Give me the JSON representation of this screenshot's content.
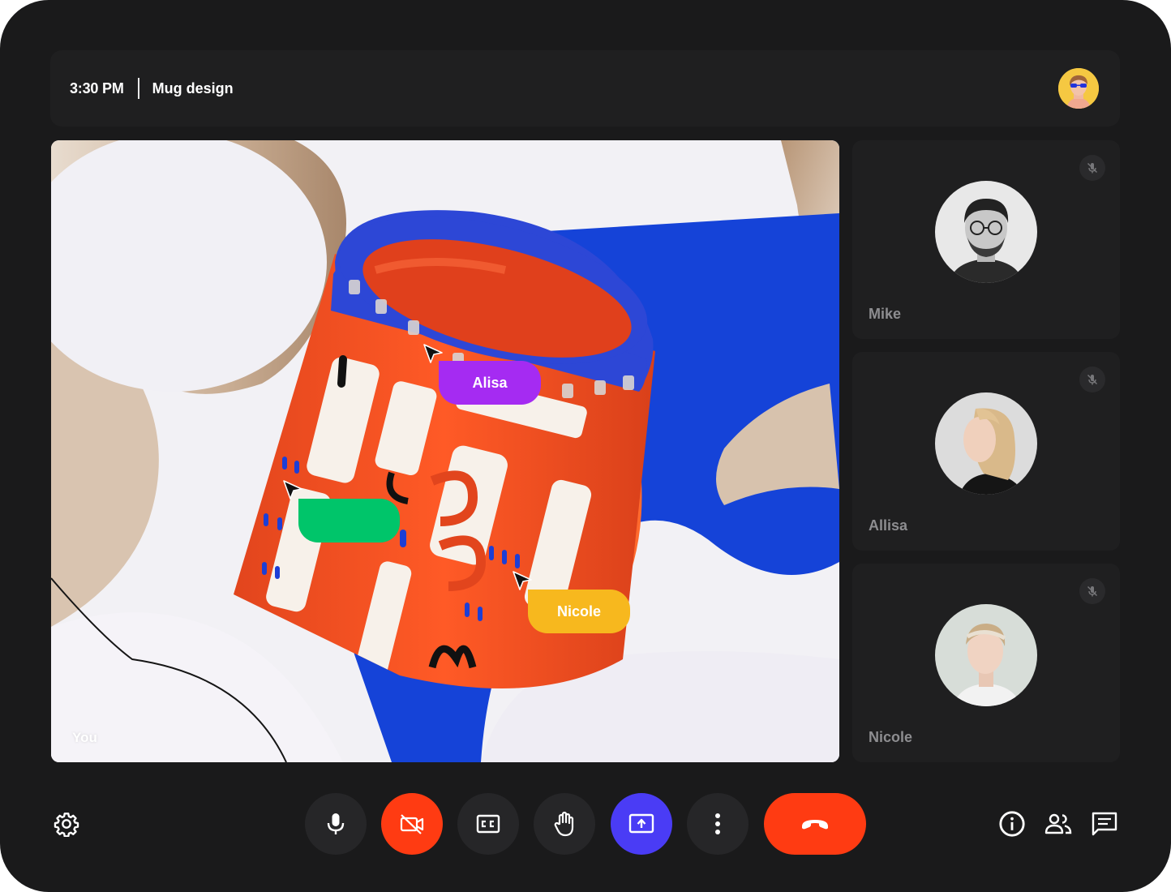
{
  "header": {
    "time": "3:30 PM",
    "meeting_title": "Mug design",
    "self_avatar_icon": "user-avatar"
  },
  "stage": {
    "self_label": "You",
    "cursors": [
      {
        "name": "Alisa",
        "color": "#a52bf2"
      },
      {
        "name": "",
        "color": "#00c56a"
      },
      {
        "name": "Nicole",
        "color": "#f7b81e"
      }
    ]
  },
  "participants": [
    {
      "name": "Mike",
      "muted": true,
      "icon": "mic-off-icon"
    },
    {
      "name": "Allisa",
      "muted": true,
      "icon": "mic-off-icon"
    },
    {
      "name": "Nicole",
      "muted": true,
      "icon": "mic-off-icon"
    }
  ],
  "controls": {
    "settings_icon": "gear-icon",
    "mic_icon": "microphone-icon",
    "camera_icon": "camera-off-icon",
    "captions_icon": "closed-captions-icon",
    "raise_hand_icon": "hand-icon",
    "share_screen_icon": "present-screen-icon",
    "more_icon": "more-vertical-icon",
    "end_call_icon": "phone-hangup-icon",
    "info_icon": "info-icon",
    "people_icon": "people-icon",
    "chat_icon": "chat-icon"
  },
  "colors": {
    "background": "#1a1a1b",
    "panel": "#1f1f20",
    "danger": "#ff3b12",
    "accent": "#4a3cf5"
  }
}
